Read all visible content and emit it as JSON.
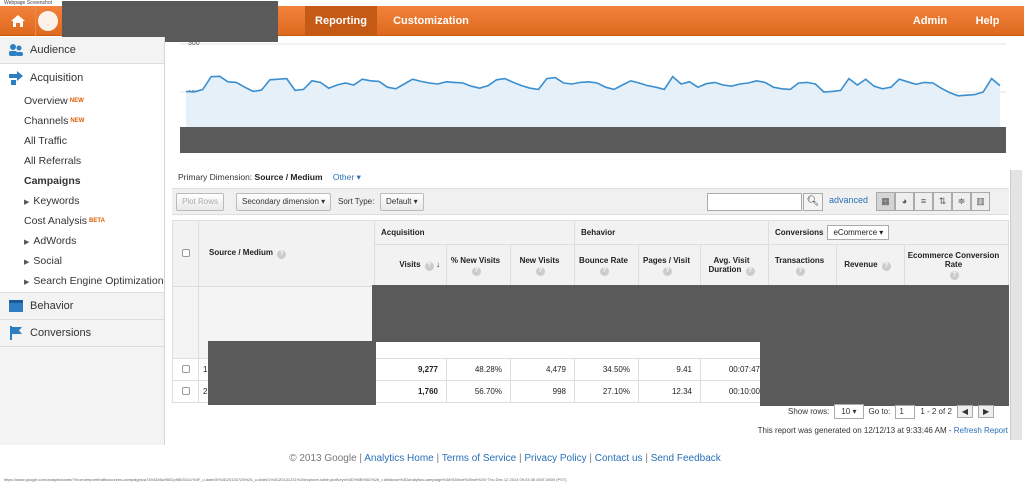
{
  "print_header": "Webpage Screenshot",
  "print_footer": "https://www.google.com/analytics/web/?hl=en#report/trafficsources-campaigns/a7494346w9502p9803311/%3F_u.date00%3D20130726%26_u.date01%3D20131211%26explorer-table.plotKeys%3D%5B%5D%26_r.drilldown%3Danalytics.campaign%3A%28not%20set%29/ Thu Dec 12 2013 09:33:36 GMT-0800 (PST)",
  "topbar": {
    "tabs": [
      "Reporting",
      "Customization"
    ],
    "admin": "Admin",
    "help": "Help"
  },
  "sidebar": {
    "audience": "Audience",
    "acquisition": "Acquisition",
    "items": [
      {
        "label": "Overview",
        "badge": "NEW"
      },
      {
        "label": "Channels",
        "badge": "NEW"
      },
      {
        "label": "All Traffic"
      },
      {
        "label": "All Referrals"
      },
      {
        "label": "Campaigns"
      },
      {
        "label": "Keywords"
      },
      {
        "label": "Cost Analysis",
        "badge": "BETA"
      },
      {
        "label": "AdWords"
      },
      {
        "label": "Social"
      },
      {
        "label": "Search Engine Optimization"
      }
    ],
    "behavior": "Behavior",
    "conversions": "Conversions"
  },
  "chart": {
    "y_labels": [
      "300",
      "150"
    ],
    "values": [
      152,
      150,
      158,
      198,
      199,
      182,
      180,
      165,
      152,
      156,
      188,
      190,
      192,
      155,
      158,
      185,
      180,
      162,
      172,
      178,
      172,
      190,
      185,
      183,
      165,
      160,
      175,
      190,
      183,
      178,
      175,
      182,
      180,
      178,
      168,
      162,
      170,
      188,
      192,
      180,
      170,
      162,
      158,
      192,
      195,
      178,
      175,
      180,
      182,
      178,
      165,
      158,
      172,
      185,
      178,
      170,
      165,
      158,
      198,
      175,
      182,
      165,
      176,
      180,
      172,
      168,
      175,
      178,
      185,
      180,
      165,
      160,
      158,
      178,
      180,
      175,
      150,
      152,
      155,
      192,
      172,
      190,
      168,
      160,
      165,
      190,
      182,
      174,
      180,
      178,
      162,
      148,
      138,
      140,
      142,
      150,
      192,
      170
    ]
  },
  "dims": {
    "label": "Primary Dimension:",
    "value": "Source / Medium",
    "other": "Other"
  },
  "toolbar": {
    "plot_rows": "Plot Rows",
    "secondary": "Secondary dimension",
    "sort_label": "Sort Type:",
    "sort_value": "Default",
    "advanced": "advanced"
  },
  "table": {
    "source_header": "Source / Medium",
    "acquisition": "Acquisition",
    "behavior": "Behavior",
    "conversions": "Conversions",
    "conv_select": "eCommerce",
    "columns": [
      "Visits",
      "% New Visits",
      "New Visits",
      "Bounce Rate",
      "Pages / Visit",
      "Avg. Visit Duration",
      "Transactions",
      "Revenue",
      "Ecommerce Conversion Rate"
    ],
    "rows": [
      {
        "idx": "1",
        "visits": "9,277",
        "pct_new": "48.28%",
        "new_visits": "4,479",
        "bounce": "34.50%",
        "pages": "9.41",
        "duration": "00:07:47"
      },
      {
        "idx": "2",
        "visits": "1,760",
        "pct_new": "56.70%",
        "new_visits": "998",
        "bounce": "27.10%",
        "pages": "12.34",
        "duration": "00:10:00"
      }
    ]
  },
  "pager": {
    "show_rows": "Show rows:",
    "rows_value": "10",
    "goto": "Go to:",
    "goto_value": "1",
    "range": "1 - 2 of 2"
  },
  "generated": {
    "text": "This report was generated on 12/12/13 at 9:33:46 AM -",
    "refresh": "Refresh Report"
  },
  "footer": {
    "copyright": "© 2013 Google",
    "links": [
      "Analytics Home",
      "Terms of Service",
      "Privacy Policy",
      "Contact us",
      "Send Feedback"
    ]
  }
}
